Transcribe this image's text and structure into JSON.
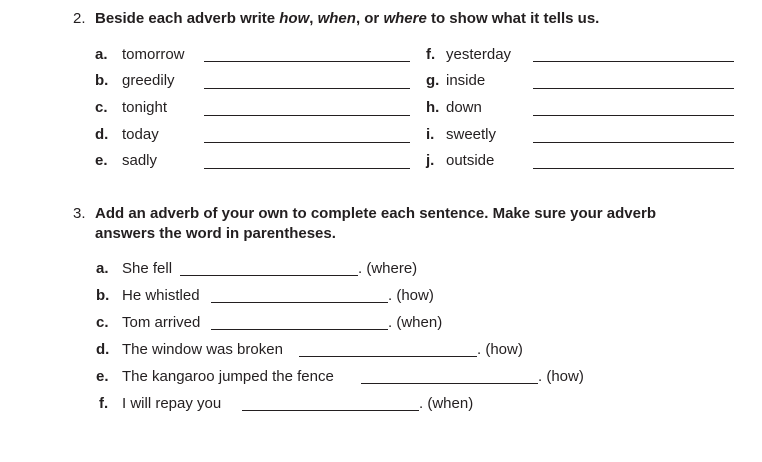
{
  "q2": {
    "number": "2.",
    "instruction_before": "Beside each adverb write ",
    "how": "how",
    "comma1": ", ",
    "when": "when",
    "or": ", or ",
    "where": "where",
    "instruction_after": " to show what it tells us.",
    "left_items": [
      {
        "letter": "a.",
        "word": "tomorrow"
      },
      {
        "letter": "b.",
        "word": "greedily"
      },
      {
        "letter": "c.",
        "word": "tonight"
      },
      {
        "letter": "d.",
        "word": "today"
      },
      {
        "letter": "e.",
        "word": "sadly"
      }
    ],
    "right_items": [
      {
        "letter": "f.",
        "word": "yesterday"
      },
      {
        "letter": "g.",
        "word": "inside"
      },
      {
        "letter": "h.",
        "word": "down"
      },
      {
        "letter": "i.",
        "word": "sweetly"
      },
      {
        "letter": "j.",
        "word": "outside"
      }
    ]
  },
  "q3": {
    "number": "3.",
    "instruction_line1": "Add an adverb of your own to complete each sentence.  Make sure your adverb",
    "instruction_line2": "answers the word in parentheses.",
    "items": [
      {
        "letter": "a.",
        "text": "She fell",
        "hint": ". (where)"
      },
      {
        "letter": "b.",
        "text": "He whistled",
        "hint": ". (how)"
      },
      {
        "letter": "c.",
        "text": "Tom arrived",
        "hint": ". (when)"
      },
      {
        "letter": "d.",
        "text": "The window was broken",
        "hint": ". (how)"
      },
      {
        "letter": "e.",
        "text": "The kangaroo jumped the fence",
        "hint": ". (how)"
      },
      {
        "letter": "f.",
        "text": "I will repay you",
        "hint": ". (when)"
      }
    ]
  }
}
